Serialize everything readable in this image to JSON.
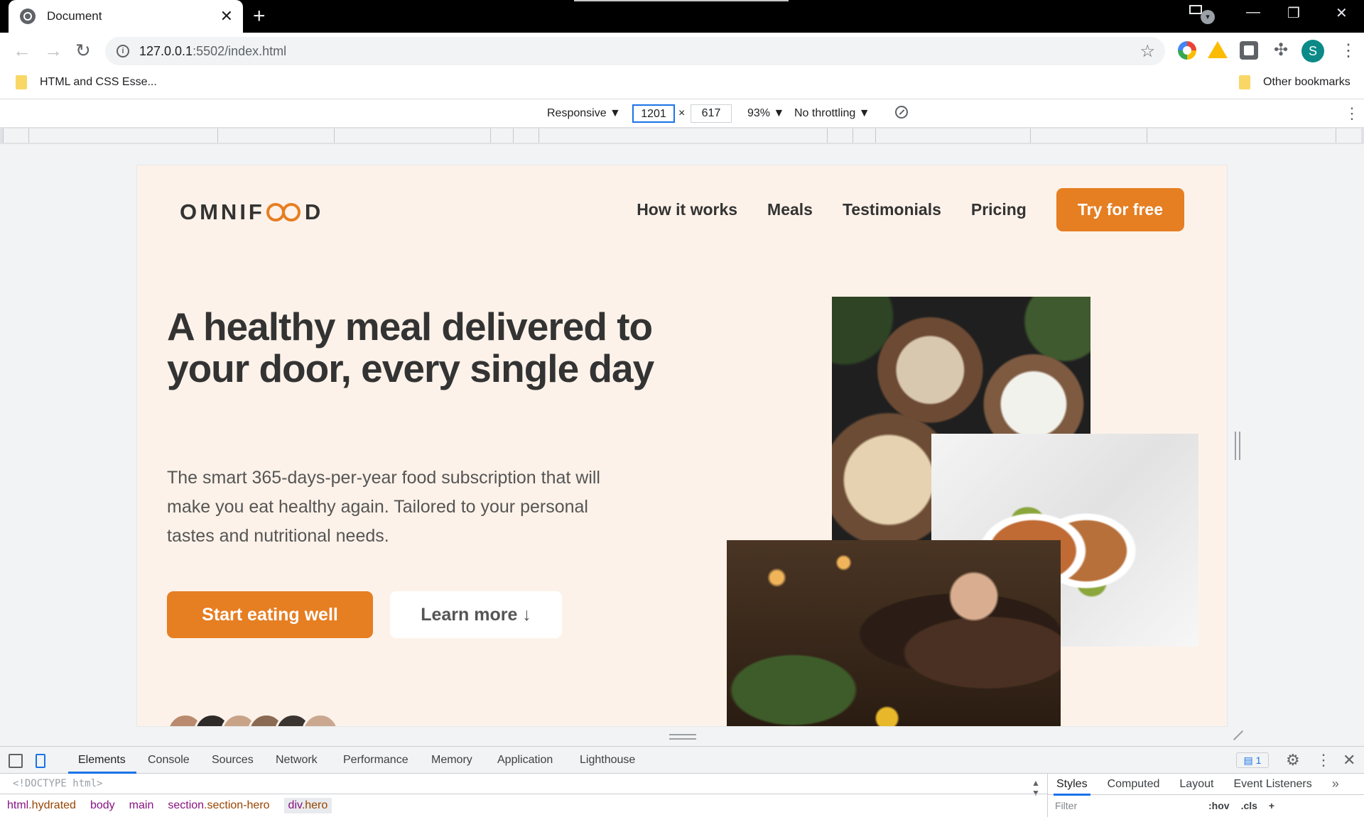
{
  "browser": {
    "tab_title": "Document",
    "tab_close": "✕",
    "new_tab": "+",
    "window_controls": {
      "minimize": "—",
      "restore": "❐",
      "close": "✕"
    },
    "url_host": "127.0.0.1",
    "url_path": ":5502/index.html",
    "avatar_letter": "S"
  },
  "bookmarks": {
    "left": "HTML and CSS Esse...",
    "right": "Other bookmarks"
  },
  "device_toolbar": {
    "mode": "Responsive ▼",
    "width": "1201",
    "x": "×",
    "height": "617",
    "zoom": "93% ▼",
    "throttling": "No throttling ▼"
  },
  "site": {
    "logo_pre": "OMNIF",
    "logo_post": "D",
    "nav": [
      "How it works",
      "Meals",
      "Testimonials",
      "Pricing"
    ],
    "nav_cta": "Try for free",
    "hero_title": "A healthy meal delivered to your door, every single day",
    "hero_text": "The smart 365-days-per-year food subscription that will make you eat healthy again. Tailored to your personal tastes and nutritional needs.",
    "btn_primary": "Start eating well",
    "btn_secondary": "Learn more ↓",
    "customer_colors": [
      "#b98a6e",
      "#2e2a28",
      "#c9a387",
      "#8a6a52",
      "#3b3532",
      "#caa890"
    ]
  },
  "devtools": {
    "tabs": [
      "Elements",
      "Console",
      "Sources",
      "Network",
      "Performance",
      "Memory",
      "Application",
      "Lighthouse"
    ],
    "issues_badge": "1",
    "dom_first_line": "<!DOCTYPE html>",
    "breadcrumbs": [
      {
        "tag": "html",
        "cls": ".hydrated"
      },
      {
        "tag": "body",
        "cls": ""
      },
      {
        "tag": "main",
        "cls": ""
      },
      {
        "tag": "section",
        "cls": ".section-hero"
      },
      {
        "tag": "div",
        "cls": ".hero"
      }
    ],
    "styles_tabs": [
      "Styles",
      "Computed",
      "Layout",
      "Event Listeners"
    ],
    "filter_placeholder": "Filter",
    "filter_tools": [
      ":hov",
      ".cls",
      "+"
    ]
  },
  "colors": {
    "accent": "#e67e22",
    "hero_bg": "#fdf2e9",
    "text_dark": "#333333",
    "devtools_blue": "#1a73e8"
  }
}
